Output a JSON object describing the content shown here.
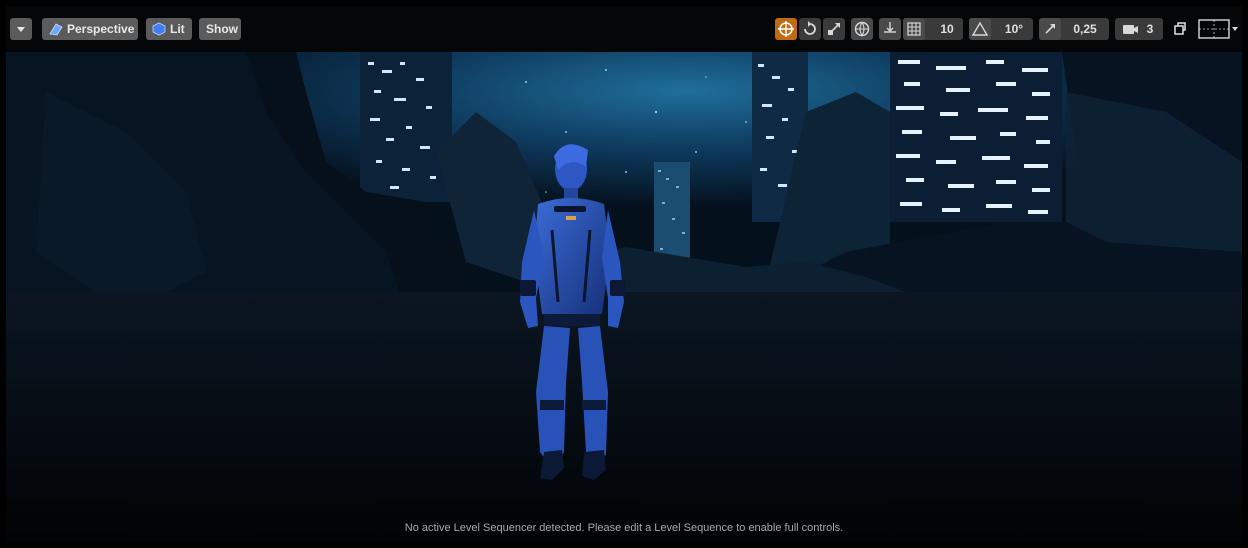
{
  "toolbar": {
    "view_mode": "Perspective",
    "lighting_mode": "Lit",
    "show_label": "Show",
    "grid_snap_value": "10",
    "rotation_snap_value": "10°",
    "scale_snap_value": "0,25",
    "camera_speed_value": "3",
    "active_color": "#c06a12"
  },
  "status": {
    "message": "No active Level Sequencer detected. Please edit a Level Sequence to enable full controls."
  }
}
